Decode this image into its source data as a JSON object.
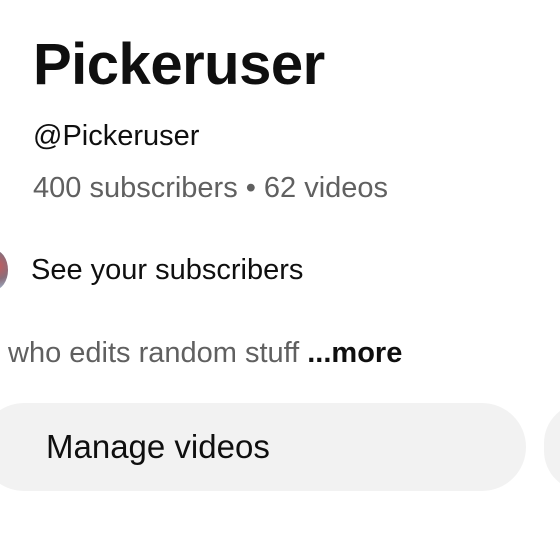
{
  "channel": {
    "name": "Pickeruser",
    "handle": "@Pickeruser",
    "subscribers": "400 subscribers",
    "separator": "•",
    "videos": "62 videos"
  },
  "subscribers_link": {
    "label": "See your subscribers",
    "icon": "subscriber-avatar"
  },
  "description": {
    "text": "who edits random stuff",
    "more_label": "...more"
  },
  "actions": {
    "manage_videos_label": "Manage videos"
  },
  "colors": {
    "primary_text": "#0f0f0f",
    "secondary_text": "#606060",
    "button_bg": "#f2f2f2"
  }
}
